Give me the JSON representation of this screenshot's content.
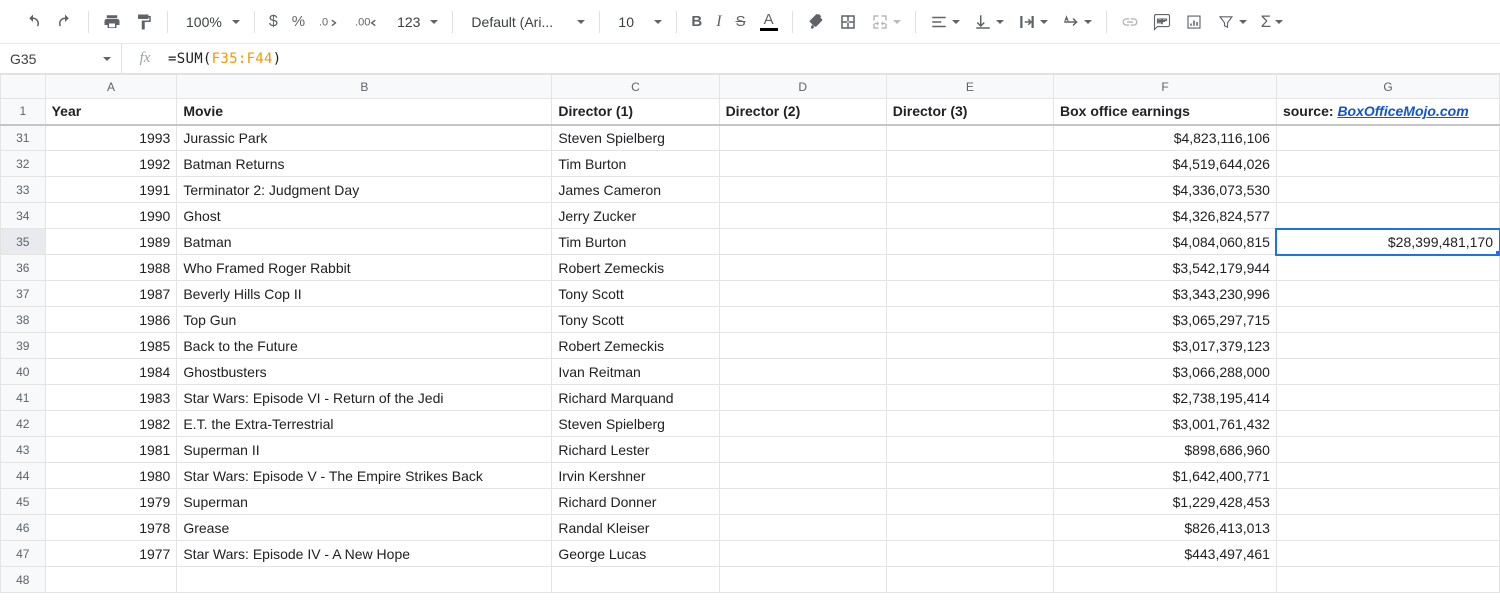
{
  "toolbar": {
    "zoom": "100%",
    "font": "Default (Ari...",
    "fontsize": "10",
    "numfmt123": "123"
  },
  "namebox": "G35",
  "formula": {
    "fn": "SUM",
    "range": "F35:F44"
  },
  "columns": [
    "A",
    "B",
    "C",
    "D",
    "E",
    "F",
    "G"
  ],
  "selected_col": "G",
  "header": {
    "rownum": "1",
    "A": "Year",
    "B": "Movie",
    "C": "Director (1)",
    "D": "Director (2)",
    "E": "Director (3)",
    "F": "Box office earnings",
    "G_label": "source: ",
    "G_link": "BoxOfficeMojo.com"
  },
  "selected_row": "35",
  "g35_value": "$28,399,481,170",
  "rows": [
    {
      "n": "31",
      "A": "1993",
      "B": "Jurassic Park",
      "C": "Steven Spielberg",
      "F": "$4,823,116,106",
      "G": ""
    },
    {
      "n": "32",
      "A": "1992",
      "B": "Batman Returns",
      "C": "Tim Burton",
      "F": "$4,519,644,026",
      "G": ""
    },
    {
      "n": "33",
      "A": "1991",
      "B": "Terminator 2: Judgment Day",
      "C": "James Cameron",
      "F": "$4,336,073,530",
      "G": ""
    },
    {
      "n": "34",
      "A": "1990",
      "B": "Ghost",
      "C": "Jerry Zucker",
      "F": "$4,326,824,577",
      "G": ""
    },
    {
      "n": "35",
      "A": "1989",
      "B": "Batman",
      "C": "Tim Burton",
      "F": "$4,084,060,815",
      "G": "$28,399,481,170"
    },
    {
      "n": "36",
      "A": "1988",
      "B": "Who Framed Roger Rabbit",
      "C": "Robert Zemeckis",
      "F": "$3,542,179,944",
      "G": ""
    },
    {
      "n": "37",
      "A": "1987",
      "B": "Beverly Hills Cop II",
      "C": "Tony Scott",
      "F": "$3,343,230,996",
      "G": ""
    },
    {
      "n": "38",
      "A": "1986",
      "B": "Top Gun",
      "C": "Tony Scott",
      "F": "$3,065,297,715",
      "G": ""
    },
    {
      "n": "39",
      "A": "1985",
      "B": "Back to the Future",
      "C": "Robert Zemeckis",
      "F": "$3,017,379,123",
      "G": ""
    },
    {
      "n": "40",
      "A": "1984",
      "B": "Ghostbusters",
      "C": "Ivan Reitman",
      "F": "$3,066,288,000",
      "G": ""
    },
    {
      "n": "41",
      "A": "1983",
      "B": "Star Wars: Episode VI - Return of the Jedi",
      "C": "Richard Marquand",
      "F": "$2,738,195,414",
      "G": ""
    },
    {
      "n": "42",
      "A": "1982",
      "B": "E.T. the Extra-Terrestrial",
      "C": "Steven Spielberg",
      "F": "$3,001,761,432",
      "G": ""
    },
    {
      "n": "43",
      "A": "1981",
      "B": "Superman II",
      "C": "Richard Lester",
      "F": "$898,686,960",
      "G": ""
    },
    {
      "n": "44",
      "A": "1980",
      "B": "Star Wars: Episode V - The Empire Strikes Back",
      "C": "Irvin Kershner",
      "F": "$1,642,400,771",
      "G": ""
    },
    {
      "n": "45",
      "A": "1979",
      "B": "Superman",
      "C": "Richard Donner",
      "F": "$1,229,428,453",
      "G": ""
    },
    {
      "n": "46",
      "A": "1978",
      "B": "Grease",
      "C": "Randal Kleiser",
      "F": "$826,413,013",
      "G": ""
    },
    {
      "n": "47",
      "A": "1977",
      "B": "Star Wars: Episode IV - A New Hope",
      "C": "George Lucas",
      "F": "$443,497,461",
      "G": ""
    },
    {
      "n": "48",
      "A": "",
      "B": "",
      "C": "",
      "F": "",
      "G": ""
    }
  ]
}
